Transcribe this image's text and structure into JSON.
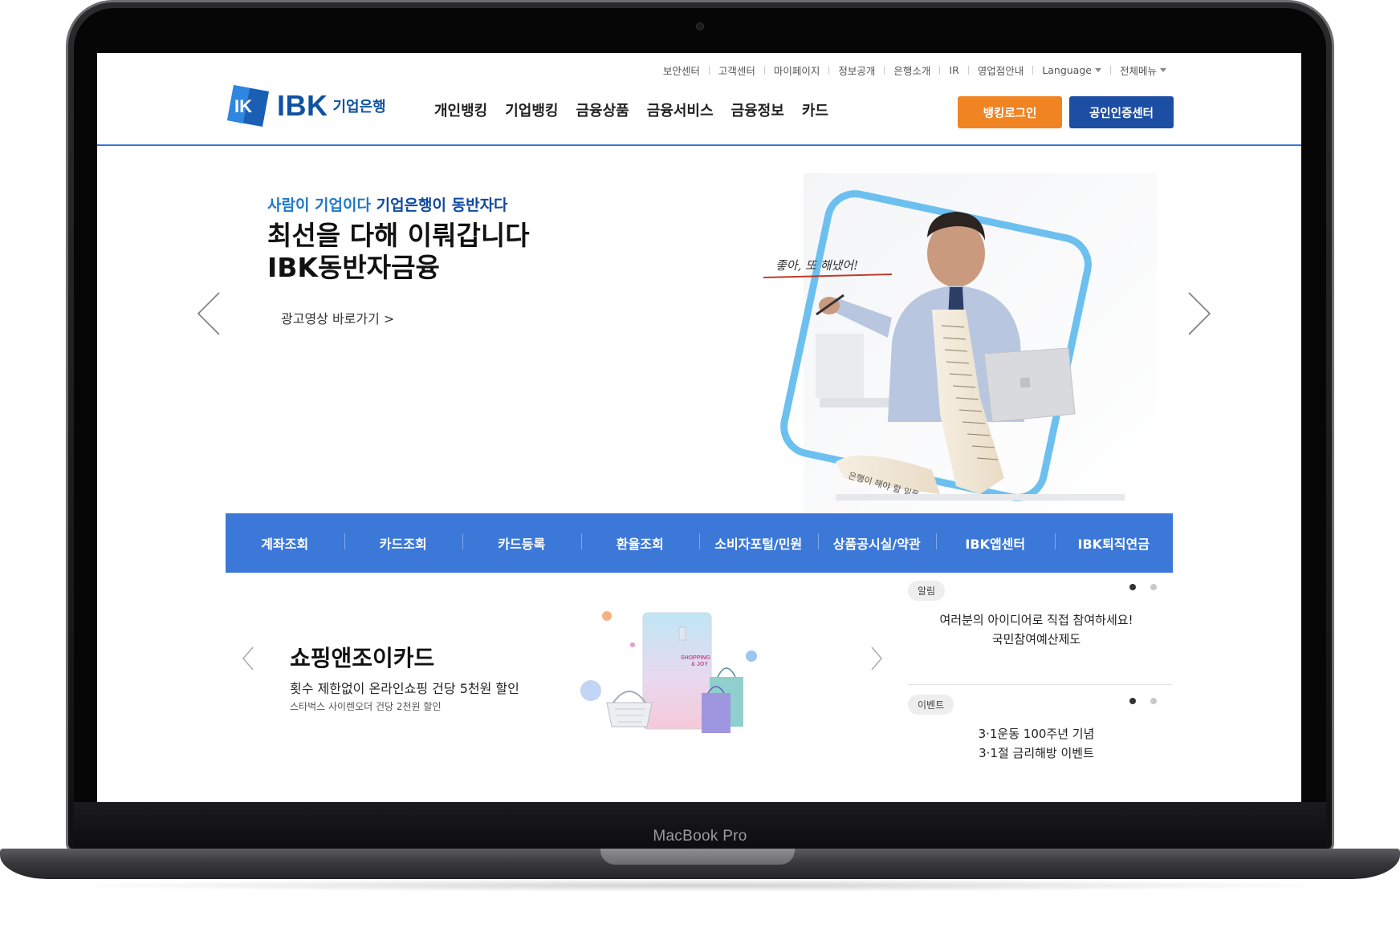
{
  "device": {
    "label": "MacBook Pro"
  },
  "utility_menu": [
    {
      "label": "보안센터",
      "dropdown": false
    },
    {
      "label": "고객센터",
      "dropdown": false
    },
    {
      "label": "마이페이지",
      "dropdown": false
    },
    {
      "label": "정보공개",
      "dropdown": false
    },
    {
      "label": "은행소개",
      "dropdown": false
    },
    {
      "label": "IR",
      "dropdown": false
    },
    {
      "label": "영업점안내",
      "dropdown": false
    },
    {
      "label": "Language",
      "dropdown": true
    },
    {
      "label": "전체메뉴",
      "dropdown": true
    }
  ],
  "logo": {
    "text": "IBK",
    "sub": "기업은행"
  },
  "gnb": [
    "개인뱅킹",
    "기업뱅킹",
    "금융상품",
    "금융서비스",
    "금융정보",
    "카드"
  ],
  "buttons": {
    "login": "뱅킹로그인",
    "cert": "공인인증센터"
  },
  "hero": {
    "eyebrow_a": "사람이 기업이다 ",
    "eyebrow_b": "기업은행이 동반자다",
    "title_line1": "최선을 다해 이뤄갑니다",
    "title_line2": "IBK동반자금융",
    "link": "광고영상 바로가기 >"
  },
  "quick_menu": [
    "계좌조회",
    "카드조회",
    "카드등록",
    "환율조회",
    "소비자포털/민원",
    "상품공시실/약관",
    "IBK앱센터",
    "IBK퇴직연금"
  ],
  "promo": {
    "title": "쇼핑앤조이카드",
    "desc": "횟수 제한없이 온라인쇼핑 건당 5천원 할인",
    "sub": "스타벅스 사이렌오더 건당 2천원 할인"
  },
  "notices": [
    {
      "badge": "알림",
      "line1": "여러분의 아이디어로 직접 참여하세요!",
      "line2": "국민참여예산제도"
    },
    {
      "badge": "이벤트",
      "line1": "3·1운동 100주년 기념",
      "line2": "3·1절 금리해방 이벤트"
    }
  ],
  "colors": {
    "brand_blue": "#1c4ea3",
    "quick_blue": "#3c78d8",
    "login_orange": "#f08322",
    "eyebrow_blue": "#1e77c9"
  },
  "icons": [
    "logo-mark-icon",
    "caret-down-icon",
    "chevron-left-icon",
    "chevron-right-icon"
  ]
}
